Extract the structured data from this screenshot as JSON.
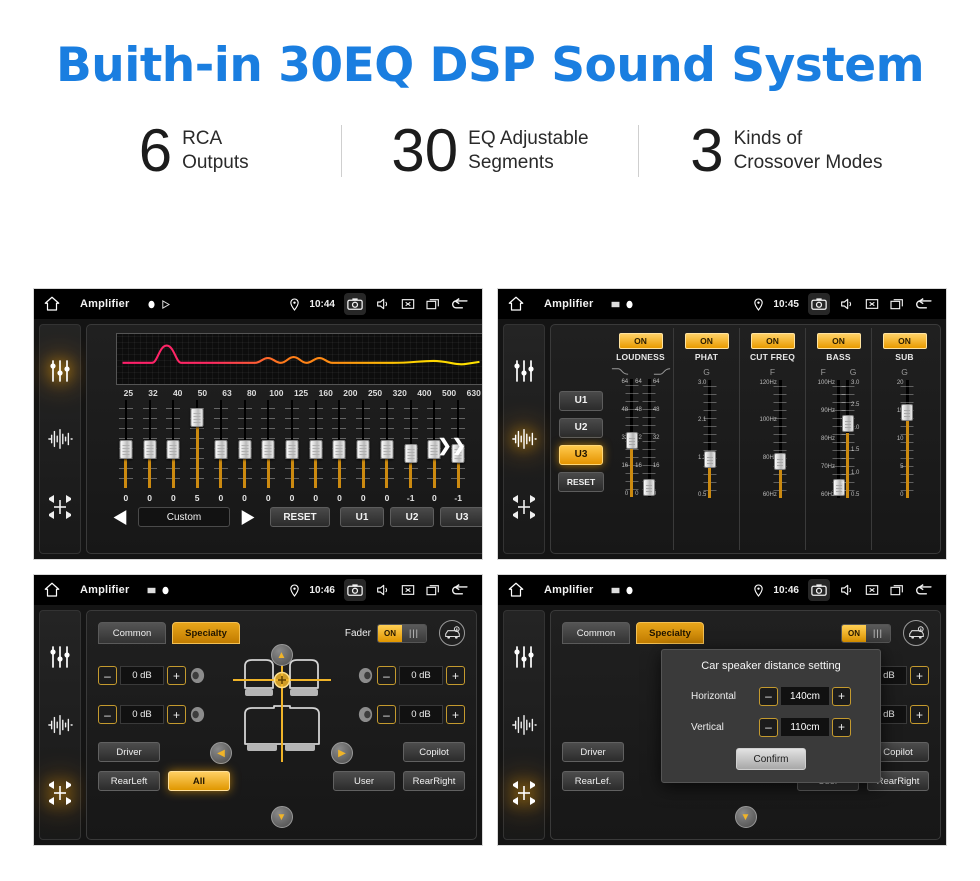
{
  "hero": {
    "title": "Buith-in 30EQ DSP Sound System"
  },
  "stats": [
    {
      "number": "6",
      "line1": "RCA",
      "line2": "Outputs"
    },
    {
      "number": "30",
      "line1": "EQ Adjustable",
      "line2": "Segments"
    },
    {
      "number": "3",
      "line1": "Kinds of",
      "line2": "Crossover Modes"
    }
  ],
  "colors": {
    "title_blue": "#1a7ee0",
    "accent_amber": "#e09700",
    "panel_dark": "#141414"
  },
  "screens": {
    "eq": {
      "statusbar": {
        "title": "Amplifier",
        "time": "10:44",
        "icons": [
          "home-icon",
          "record-dot-icon",
          "play-triangle-icon",
          "location-pin-icon",
          "camera-icon",
          "volume-icon",
          "close-box-icon",
          "recents-icon",
          "back-arrow-icon"
        ]
      },
      "rail": [
        {
          "name": "equalizer-icon",
          "active": true
        },
        {
          "name": "waveform-icon",
          "active": false
        },
        {
          "name": "balance-icon",
          "active": false
        }
      ],
      "frequencies": [
        "25",
        "32",
        "40",
        "50",
        "63",
        "80",
        "100",
        "125",
        "160",
        "200",
        "250",
        "320",
        "400",
        "500",
        "630"
      ],
      "values": [
        "0",
        "0",
        "0",
        "5",
        "0",
        "0",
        "0",
        "0",
        "0",
        "0",
        "0",
        "0",
        "-1",
        "0",
        "-1"
      ],
      "preset": "Custom",
      "buttons": {
        "prev": "◀",
        "next": "▶",
        "reset": "RESET",
        "u1": "U1",
        "u2": "U2",
        "u3": "U3",
        "more": "❯❯"
      }
    },
    "dsp": {
      "statusbar": {
        "title": "Amplifier",
        "time": "10:45"
      },
      "rail": [
        {
          "name": "equalizer-icon",
          "active": false
        },
        {
          "name": "waveform-icon",
          "active": true
        },
        {
          "name": "balance-icon",
          "active": false
        }
      ],
      "user_buttons": [
        {
          "label": "U1",
          "active": false
        },
        {
          "label": "U2",
          "active": false
        },
        {
          "label": "U3",
          "active": true
        },
        {
          "label": "RESET",
          "active": false
        }
      ],
      "sections": [
        {
          "label": "LOUDNESS",
          "state": "ON",
          "headers": [
            "curve-down-icon",
            "curve-up-icon"
          ],
          "sliders": [
            {
              "scale_left": [
                "64",
                "48",
                "32",
                "16",
                "0"
              ],
              "scale_right": [
                "64",
                "48",
                "32",
                "16",
                "0"
              ],
              "pos": 50
            },
            {
              "scale_left": [
                "64",
                "48",
                "32",
                "16",
                "0"
              ],
              "scale_right": [
                "64",
                "48",
                "32",
                "16",
                "0"
              ],
              "pos": 8
            }
          ]
        },
        {
          "label": "PHAT",
          "state": "ON",
          "headers": [
            "G"
          ],
          "sliders": [
            {
              "scale_left": [
                "3.0",
                "2.1",
                "1.3",
                "0.5"
              ],
              "scale_right": [
                "",
                "",
                "",
                ""
              ],
              "pos": 33
            }
          ]
        },
        {
          "label": "CUT FREQ",
          "state": "ON",
          "headers": [
            "F"
          ],
          "sliders": [
            {
              "scale_left": [
                "120Hz",
                "100Hz",
                "80Hz",
                "60Hz"
              ],
              "scale_right": [
                "",
                "",
                "",
                ""
              ],
              "pos": 30
            }
          ]
        },
        {
          "label": "BASS",
          "state": "ON",
          "headers": [
            "F",
            "G"
          ],
          "sliders": [
            {
              "scale_left": [
                "100Hz",
                "90Hz",
                "80Hz",
                "70Hz",
                "60Hz"
              ],
              "scale_right": [
                "",
                "",
                "",
                "",
                ""
              ],
              "pos": 4
            },
            {
              "scale_left": [
                "",
                "",
                "",
                "",
                ""
              ],
              "scale_right": [
                "3.0",
                "2.5",
                "2.0",
                "1.5",
                "1.0",
                "0.5"
              ],
              "pos": 58
            }
          ]
        },
        {
          "label": "SUB",
          "state": "ON",
          "headers": [
            "G"
          ],
          "sliders": [
            {
              "scale_left": [
                "20",
                "15",
                "10",
                "5",
                "0"
              ],
              "scale_right": [
                "",
                "",
                "",
                "",
                ""
              ],
              "pos": 72
            }
          ]
        }
      ]
    },
    "fader": {
      "statusbar": {
        "title": "Amplifier",
        "time": "10:46"
      },
      "rail": [
        {
          "name": "equalizer-icon",
          "active": false
        },
        {
          "name": "waveform-icon",
          "active": false
        },
        {
          "name": "balance-icon",
          "active": true
        }
      ],
      "tabs": [
        {
          "label": "Common",
          "active": false
        },
        {
          "label": "Specialty",
          "active": true
        }
      ],
      "fader_label": "Fader",
      "fader_toggle": "ON",
      "car_settings_icon": "car-gear-icon",
      "steppers": [
        {
          "position": "front-left",
          "value": "0 dB",
          "minus": "–",
          "plus": "+"
        },
        {
          "position": "rear-left",
          "value": "0 dB",
          "minus": "–",
          "plus": "+"
        },
        {
          "position": "front-right",
          "value": "0 dB",
          "minus": "–",
          "plus": "+"
        },
        {
          "position": "rear-right",
          "value": "0 dB",
          "minus": "–",
          "plus": "+"
        }
      ],
      "position_buttons": [
        {
          "label": "Driver",
          "active": false
        },
        {
          "label": "Copilot",
          "active": false
        },
        {
          "label": "RearLeft",
          "active": false
        },
        {
          "label": "All",
          "active": true
        },
        {
          "label": "User",
          "active": false
        },
        {
          "label": "RearRight",
          "active": false
        }
      ],
      "nav_arrows": [
        "up",
        "down",
        "left",
        "right"
      ]
    },
    "distance": {
      "statusbar": {
        "title": "Amplifier",
        "time": "10:46"
      },
      "rail": [
        {
          "name": "equalizer-icon",
          "active": false
        },
        {
          "name": "waveform-icon",
          "active": false
        },
        {
          "name": "balance-icon",
          "active": true
        }
      ],
      "tabs": [
        {
          "label": "Common",
          "active": false
        },
        {
          "label": "Specialty",
          "active": true
        }
      ],
      "fader_toggle": "ON",
      "dialog": {
        "title": "Car speaker distance setting",
        "horizontal_label": "Horizontal",
        "horizontal_value": "140cm",
        "vertical_label": "Vertical",
        "vertical_value": "110cm",
        "minus": "–",
        "plus": "+",
        "confirm": "Confirm"
      },
      "position_buttons": [
        {
          "label": "Driver",
          "active": false
        },
        {
          "label": "Copilot",
          "active": false
        },
        {
          "label": "RearLef.",
          "active": false
        },
        {
          "label": "User",
          "active": false
        },
        {
          "label": "RearRight",
          "active": false
        }
      ],
      "steppers": [
        {
          "position": "front-right",
          "value": "0 dB"
        },
        {
          "position": "rear-right",
          "value": "0 dB"
        }
      ]
    }
  }
}
